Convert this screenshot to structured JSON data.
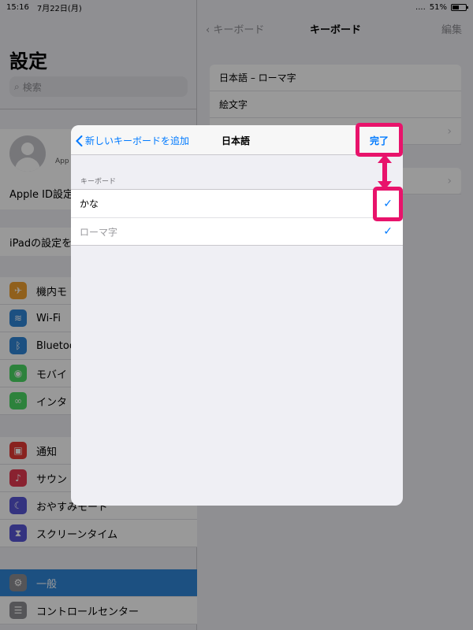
{
  "status_bar": {
    "time": "15:16",
    "date": "7月22日(月)",
    "battery": "51%",
    "battery_level": 0.51
  },
  "sidebar": {
    "title": "設定",
    "search_placeholder": "検索",
    "profile_sub": "App",
    "apple_id_label": "Apple ID設定",
    "ipad_row": "iPadの設定を",
    "group1": [
      {
        "label": "機内モ",
        "icon": "airplane-icon",
        "color": "#f0a030",
        "glyph": "✈"
      },
      {
        "label": "Wi-Fi",
        "icon": "wifi-icon",
        "color": "#2f86d8",
        "glyph": "≋"
      },
      {
        "label": "Bluetoo",
        "icon": "bluetooth-icon",
        "color": "#2f86d8",
        "glyph": "ᛒ"
      },
      {
        "label": "モバイ",
        "icon": "cellular-icon",
        "color": "#4cd964",
        "glyph": "◉"
      },
      {
        "label": "インタ",
        "icon": "personal-hotspot-icon",
        "color": "#4cd964",
        "glyph": "∞"
      }
    ],
    "group2": [
      {
        "label": "通知",
        "icon": "notifications-icon",
        "color": "#e53935",
        "glyph": "▣"
      },
      {
        "label": "サウン",
        "icon": "sounds-icon",
        "color": "#e53950",
        "glyph": "♪"
      },
      {
        "label": "おやすみモード",
        "icon": "do-not-disturb-icon",
        "color": "#5856d6",
        "glyph": "☾"
      },
      {
        "label": "スクリーンタイム",
        "icon": "screen-time-icon",
        "color": "#5856d6",
        "glyph": "⧗"
      }
    ],
    "group3": [
      {
        "label": "一般",
        "icon": "general-icon",
        "color": "#8e8e93",
        "glyph": "⚙",
        "selected": true
      },
      {
        "label": "コントロールセンター",
        "icon": "control-center-icon",
        "color": "#8e8e93",
        "glyph": "☰"
      }
    ]
  },
  "detail": {
    "back_label": "キーボード",
    "title": "キーボード",
    "edit_label": "編集",
    "rows": [
      "日本語 – ローマ字",
      "絵文字"
    ]
  },
  "modal": {
    "back_label": "新しいキーボードを追加",
    "title": "日本語",
    "done_label": "完了",
    "section_label": "キーボード",
    "options": [
      {
        "label": "かな",
        "checked": true,
        "disabled": false
      },
      {
        "label": "ローマ字",
        "checked": true,
        "disabled": true
      }
    ]
  },
  "colors": {
    "accent": "#007aff",
    "highlight": "#e8136b",
    "selected_row": "#2f86d8"
  }
}
